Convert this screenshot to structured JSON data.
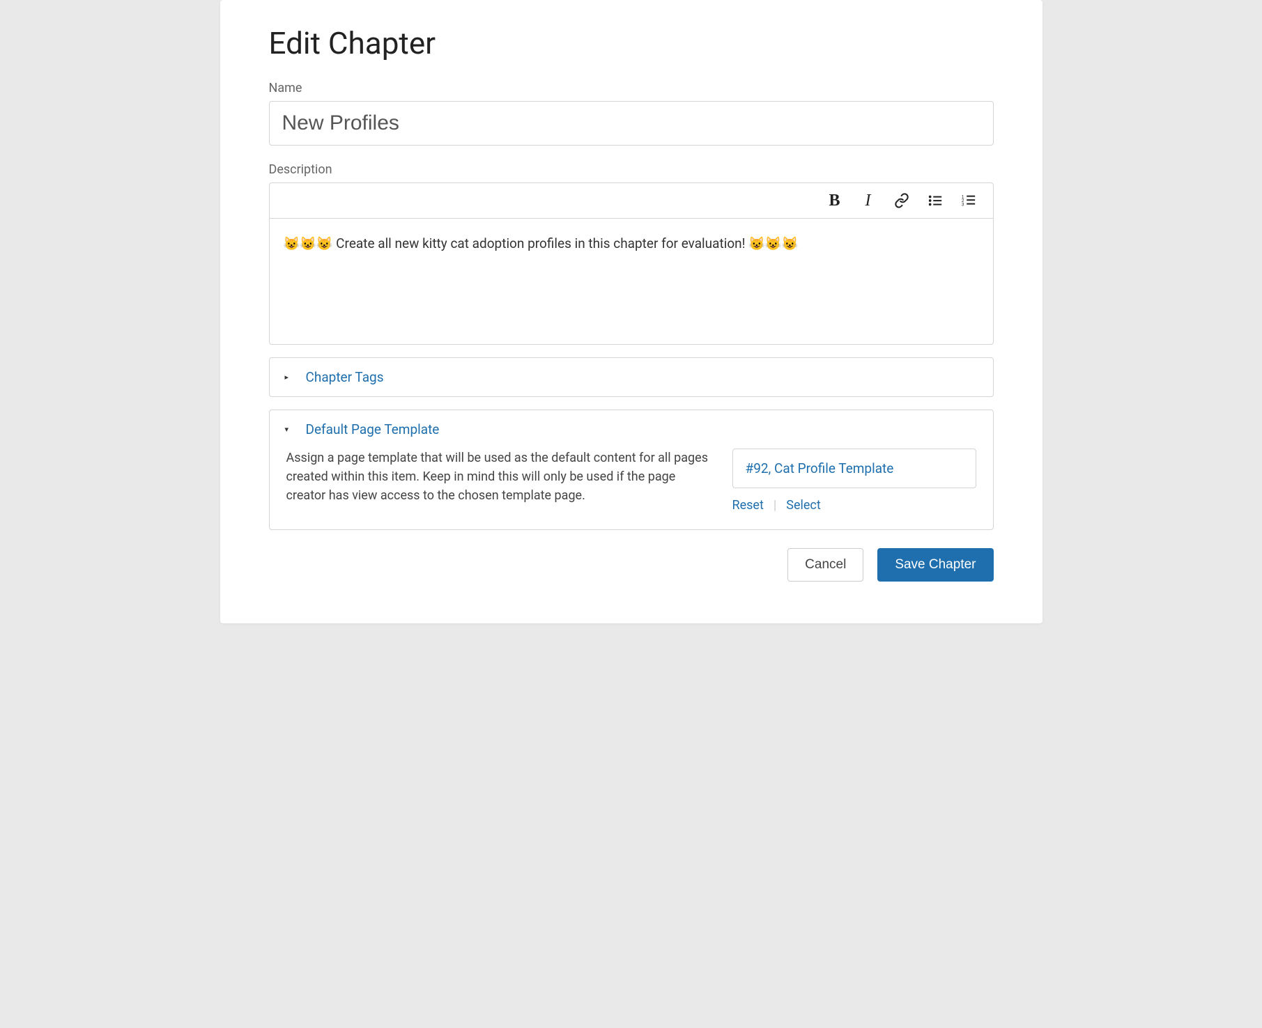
{
  "page": {
    "title": "Edit Chapter"
  },
  "fields": {
    "name_label": "Name",
    "name_value": "New Profiles",
    "description_label": "Description",
    "description_value": "😺😺😺 Create all new kitty cat adoption profiles in this chapter for evaluation! 😺😺😺"
  },
  "panels": {
    "tags": {
      "title": "Chapter Tags",
      "expanded": false
    },
    "template": {
      "title": "Default Page Template",
      "expanded": true,
      "description": "Assign a page template that will be used as the default content for all pages created within this item. Keep in mind this will only be used if the page creator has view access to the chosen template page.",
      "selected": "#92, Cat Profile Template",
      "reset_label": "Reset",
      "select_label": "Select"
    }
  },
  "buttons": {
    "cancel": "Cancel",
    "save": "Save Chapter"
  }
}
